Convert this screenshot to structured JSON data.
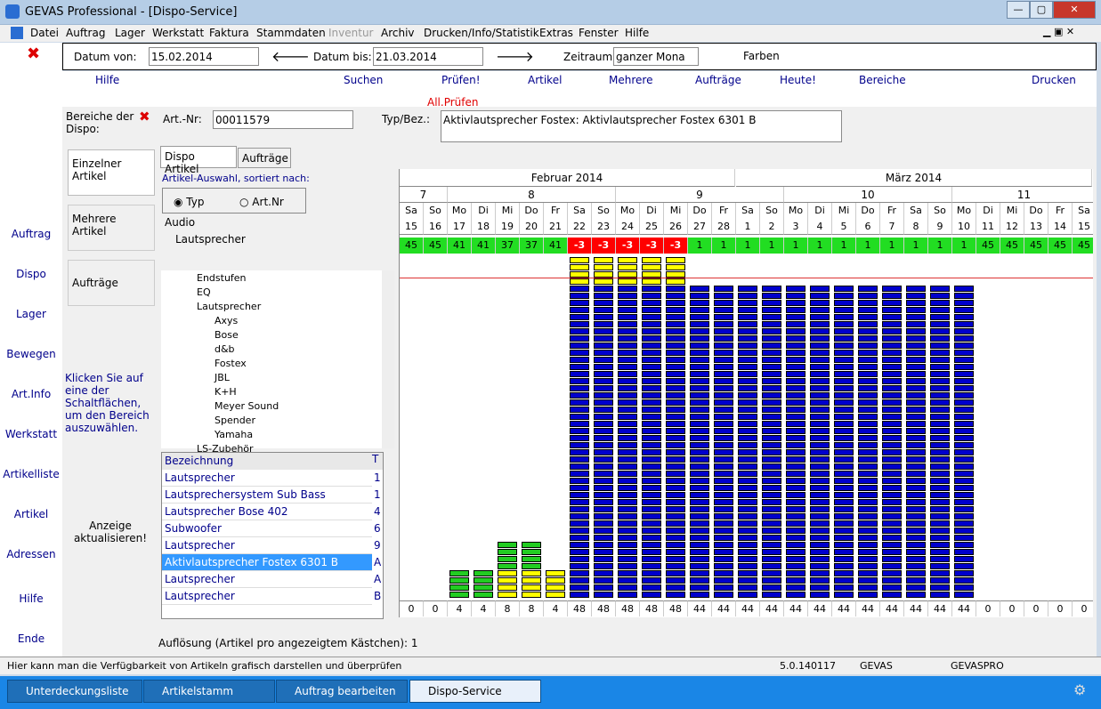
{
  "window": {
    "title": "GEVAS Professional - [Dispo-Service]"
  },
  "menu": [
    "Datei",
    "Auftrag",
    "Lager",
    "Werkstatt",
    "Faktura",
    "Stammdaten",
    "Inventur",
    "Archiv",
    "Drucken/Info/Statistik",
    "Extras",
    "Fenster",
    "Hilfe"
  ],
  "datebar": {
    "from_label": "Datum von:",
    "from_value": "15.02.2014",
    "to_label": "Datum bis:",
    "to_value": "21.03.2014",
    "range_label": "Zeitraum:",
    "range_value": "ganzer Mona",
    "colors_label": "Farben"
  },
  "toolbar": {
    "hilfe": "Hilfe",
    "suchen": "Suchen",
    "pruefen": "Prüfen!",
    "all_pruefen": "All.Prüfen",
    "artikel": "Artikel",
    "mehrere": "Mehrere",
    "auftraege": "Aufträge",
    "heute": "Heute!",
    "bereiche": "Bereiche",
    "drucken": "Drucken"
  },
  "left": [
    "Auftrag",
    "Dispo",
    "Lager",
    "Bewegen",
    "Art.Info",
    "Werkstatt",
    "Artikelliste",
    "Artikel",
    "Adressen",
    "Hilfe",
    "Ende"
  ],
  "areas": {
    "title": "Bereiche der Dispo:",
    "btn1": "Einzelner Artikel",
    "btn2": "Mehrere Artikel",
    "btn3": "Aufträge",
    "hint": "Klicken Sie auf eine der Schaltflächen, um den Bereich auszuwählen.",
    "refresh": "Anzeige aktualisieren!"
  },
  "article": {
    "nr_label": "Art.-Nr:",
    "nr": "00011579",
    "type_label": "Typ/Bez.:",
    "desc": "Aktivlautsprecher Fostex: Aktivlautsprecher Fostex 6301 B"
  },
  "tabs": [
    "Dispo Artikel",
    "Aufträge"
  ],
  "sort": {
    "label": "Artikel-Auswahl, sortiert nach:",
    "typ": "Typ",
    "artnr": "Art.Nr",
    "level1": "Audio",
    "level2": "Lautsprecher"
  },
  "tree": [
    "Endstufen",
    "EQ",
    "Lautsprecher",
    "Axys",
    "Bose",
    "d&b",
    "Fostex",
    "JBL",
    "K+H",
    "Meyer Sound",
    "Spender",
    "Yamaha",
    "LS-Zubehör"
  ],
  "list": {
    "header": "Bezeichnung",
    "col2": "T",
    "rows": [
      [
        "Lautsprecher",
        "1"
      ],
      [
        "Lautsprechersystem Sub Bass",
        "1"
      ],
      [
        "Lautsprecher Bose 402",
        "4"
      ],
      [
        "Subwoofer",
        "6"
      ],
      [
        "Lautsprecher",
        "9"
      ],
      [
        "Aktivlautsprecher Fostex 6301 B",
        "A"
      ],
      [
        "Lautsprecher",
        "A"
      ],
      [
        "Lautsprecher",
        "B"
      ]
    ]
  },
  "months": [
    "Februar 2014",
    "März 2014"
  ],
  "weeks": [
    "7",
    "8",
    "9",
    "10",
    "11"
  ],
  "days": [
    [
      "Sa",
      "15"
    ],
    [
      "So",
      "16"
    ],
    [
      "Mo",
      "17"
    ],
    [
      "Di",
      "18"
    ],
    [
      "Mi",
      "19"
    ],
    [
      "Do",
      "20"
    ],
    [
      "Fr",
      "21"
    ],
    [
      "Sa",
      "22"
    ],
    [
      "So",
      "23"
    ],
    [
      "Mo",
      "24"
    ],
    [
      "Di",
      "25"
    ],
    [
      "Mi",
      "26"
    ],
    [
      "Do",
      "27"
    ],
    [
      "Fr",
      "28"
    ],
    [
      "Sa",
      "1"
    ],
    [
      "So",
      "2"
    ],
    [
      "Mo",
      "3"
    ],
    [
      "Di",
      "4"
    ],
    [
      "Mi",
      "5"
    ],
    [
      "Do",
      "6"
    ],
    [
      "Fr",
      "7"
    ],
    [
      "Sa",
      "8"
    ],
    [
      "So",
      "9"
    ],
    [
      "Mo",
      "10"
    ],
    [
      "Di",
      "11"
    ],
    [
      "Mi",
      "12"
    ],
    [
      "Do",
      "13"
    ],
    [
      "Fr",
      "14"
    ],
    [
      "Sa",
      "15"
    ]
  ],
  "availability": [
    "45",
    "45",
    "41",
    "41",
    "37",
    "37",
    "41",
    "-3",
    "-3",
    "-3",
    "-3",
    "-3",
    "1",
    "1",
    "1",
    "1",
    "1",
    "1",
    "1",
    "1",
    "1",
    "1",
    "1",
    "1",
    "45",
    "45",
    "45",
    "45",
    "45"
  ],
  "totals": [
    "0",
    "0",
    "4",
    "4",
    "8",
    "8",
    "4",
    "48",
    "48",
    "48",
    "48",
    "48",
    "44",
    "44",
    "44",
    "44",
    "44",
    "44",
    "44",
    "44",
    "44",
    "44",
    "44",
    "44",
    "0",
    "0",
    "0",
    "0",
    "0"
  ],
  "resolution": "Auflösung (Artikel pro angezeigtem Kästchen): 1",
  "status": {
    "text": "Hier kann man die Verfügbarkeit von Artikeln grafisch darstellen und überprüfen",
    "version": "5.0.140117",
    "app": "GEVAS",
    "db": "GEVASPRO"
  },
  "tasks": [
    "Unterdeckungsliste",
    "Artikelstamm",
    "Auftrag bearbeiten",
    "Dispo-Service"
  ]
}
